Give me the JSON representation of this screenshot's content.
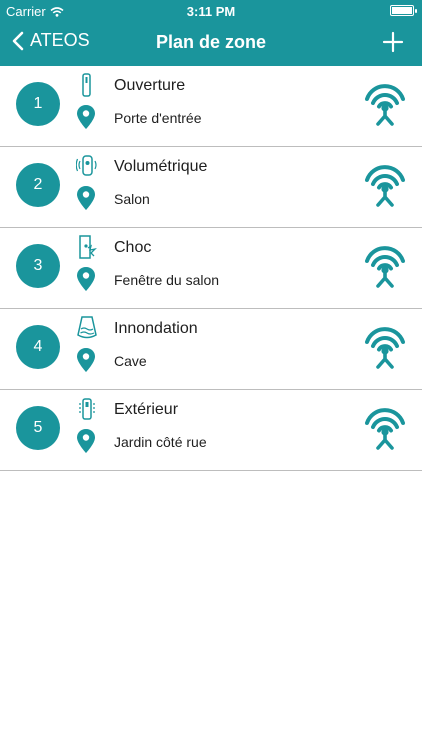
{
  "status_bar": {
    "carrier": "Carrier",
    "time": "3:11 PM"
  },
  "navbar": {
    "back_label": "ATEOS",
    "title": "Plan de zone"
  },
  "zones": [
    {
      "number": "1",
      "name": "Ouverture",
      "location": "Porte d'entrée",
      "type_icon": "door-sensor-icon"
    },
    {
      "number": "2",
      "name": "Volumétrique",
      "location": "Salon",
      "type_icon": "motion-sensor-icon"
    },
    {
      "number": "3",
      "name": "Choc",
      "location": "Fenêtre du salon",
      "type_icon": "shock-sensor-icon"
    },
    {
      "number": "4",
      "name": "Innondation",
      "location": "Cave",
      "type_icon": "flood-sensor-icon"
    },
    {
      "number": "5",
      "name": "Extérieur",
      "location": "Jardin côté rue",
      "type_icon": "outdoor-sensor-icon"
    }
  ],
  "colors": {
    "accent": "#1a959c",
    "divider": "#bdbdbd"
  }
}
